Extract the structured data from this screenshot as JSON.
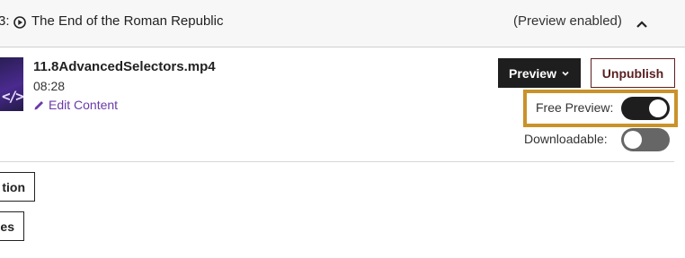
{
  "header": {
    "lecture_prefix": "3:",
    "lecture_title": "The End of the Roman Republic",
    "preview_status": "(Preview enabled)",
    "collapse_icon": "chevron-up-icon"
  },
  "media": {
    "file_name": "11.8AdvancedSelectors.mp4",
    "duration": "08:28",
    "edit_label": "Edit Content",
    "thumbnail_glyph": "</>"
  },
  "actions": {
    "preview_label": "Preview",
    "unpublish_label": "Unpublish"
  },
  "settings": {
    "free_preview_label": "Free Preview:",
    "free_preview_on": true,
    "downloadable_label": "Downloadable:",
    "downloadable_on": false
  },
  "chips": [
    {
      "label": "tion"
    },
    {
      "label": "ces"
    }
  ],
  "colors": {
    "highlight": "#c9922a",
    "link": "#6b3aa8",
    "unpublish": "#5a1f1f"
  }
}
